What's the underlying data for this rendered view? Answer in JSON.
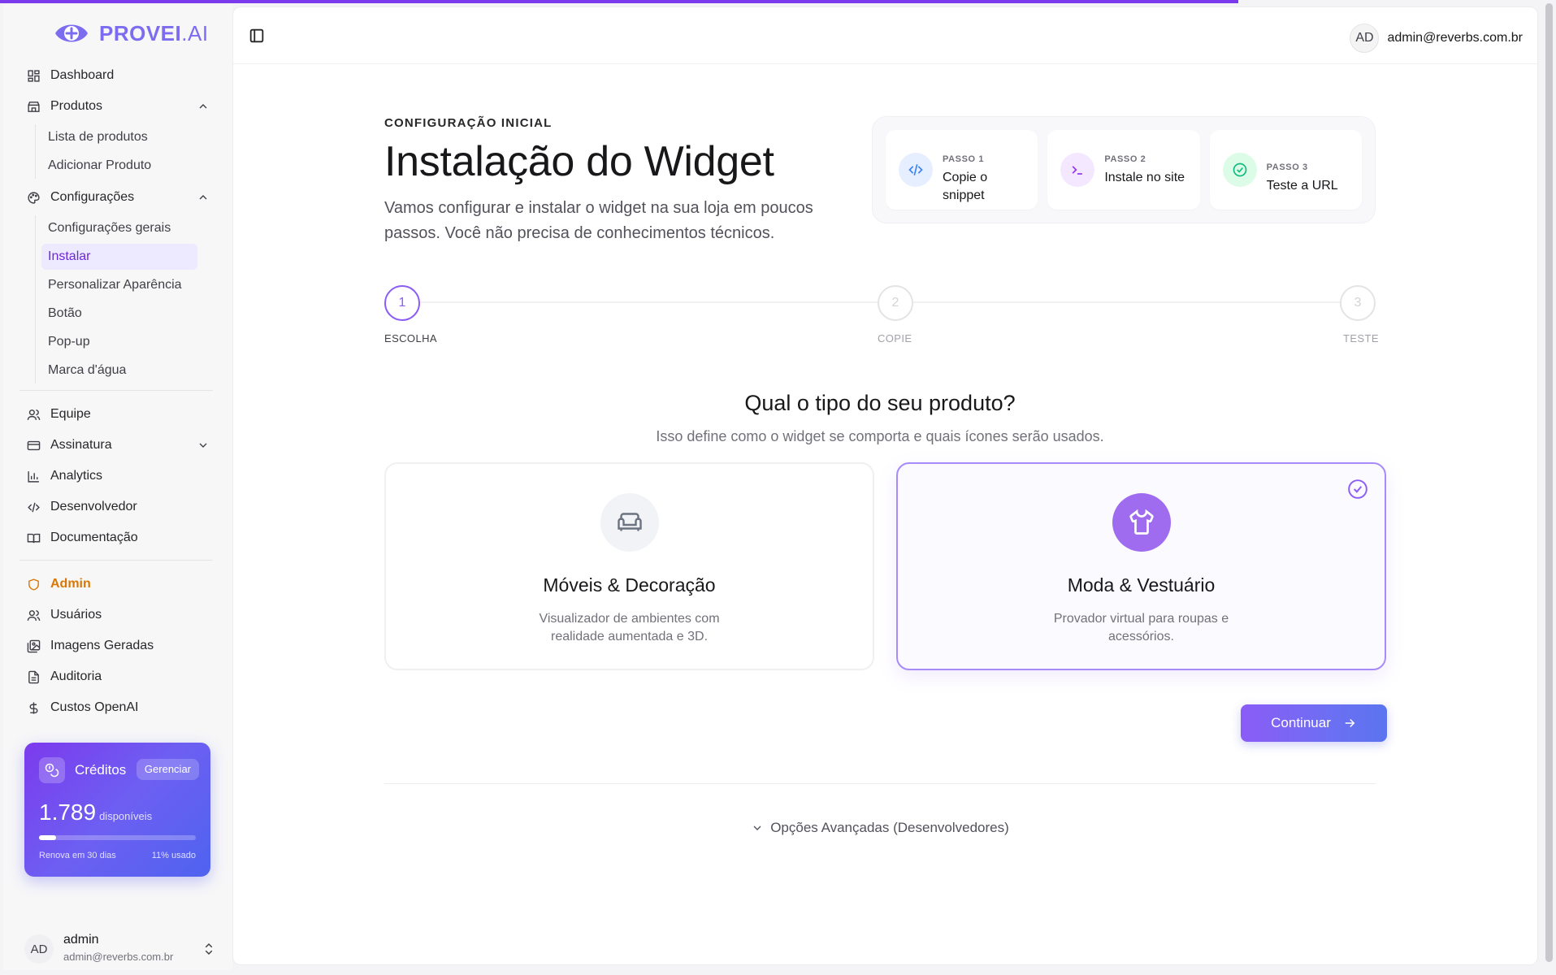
{
  "colors": {
    "accent": "#7c3aed",
    "brand": "#7c6cf0",
    "admin": "#d97706"
  },
  "top_progress": 0.796,
  "brand": {
    "name": "PROVEI",
    "suffix": ".AI"
  },
  "sidebar": {
    "items": [
      {
        "label": "Dashboard",
        "icon": "dashboard-icon"
      },
      {
        "label": "Produtos",
        "icon": "store-icon",
        "expanded": true,
        "children": [
          "Lista de produtos",
          "Adicionar Produto"
        ]
      },
      {
        "label": "Configurações",
        "icon": "palette-icon",
        "expanded": true,
        "children": [
          "Configurações gerais",
          "Instalar",
          "Personalizar Aparência",
          "Botão",
          "Pop-up",
          "Marca d'água"
        ],
        "active_child": "Instalar"
      },
      {
        "label": "Equipe",
        "icon": "users-icon"
      },
      {
        "label": "Assinatura",
        "icon": "credit-card-icon",
        "expanded": false
      },
      {
        "label": "Analytics",
        "icon": "bar-chart-icon"
      },
      {
        "label": "Desenvolvedor",
        "icon": "code-icon"
      },
      {
        "label": "Documentação",
        "icon": "book-icon"
      }
    ],
    "admin_section": {
      "label": "Admin",
      "items": [
        {
          "label": "Usuários",
          "icon": "users-icon"
        },
        {
          "label": "Imagens Geradas",
          "icon": "images-icon"
        },
        {
          "label": "Auditoria",
          "icon": "file-text-icon"
        },
        {
          "label": "Custos OpenAI",
          "icon": "dollar-icon"
        }
      ]
    },
    "credits": {
      "title": "Créditos",
      "manage_label": "Gerenciar",
      "value": "1.789",
      "available_label": "disponíveis",
      "used_fraction": 0.11,
      "renew_text": "Renova em 30 dias",
      "used_text": "11% usado"
    },
    "user": {
      "initials": "AD",
      "name": "admin",
      "email": "admin@reverbs.com.br"
    }
  },
  "topbar": {
    "initials": "AD",
    "email": "admin@reverbs.com.br"
  },
  "header": {
    "kicker": "CONFIGURAÇÃO INICIAL",
    "title": "Instalação do Widget",
    "description": "Vamos configurar e instalar o widget na sua loja em poucos passos. Você não precisa de conhecimentos técnicos."
  },
  "steps_overview": [
    {
      "label": "PASSO 1",
      "text": "Copie o snippet",
      "icon": "code-icon",
      "color": "#3b82f6",
      "bg": "#e6efff"
    },
    {
      "label": "PASSO 2",
      "text": "Instale no site",
      "icon": "terminal-icon",
      "color": "#9333ea",
      "bg": "#f3e8ff"
    },
    {
      "label": "PASSO 3",
      "text": "Teste a URL",
      "icon": "check-circle-icon",
      "color": "#10b981",
      "bg": "#dcfce7"
    }
  ],
  "stepper": [
    {
      "number": "1",
      "label": "ESCOLHA",
      "active": true
    },
    {
      "number": "2",
      "label": "COPIE",
      "active": false
    },
    {
      "number": "3",
      "label": "TESTE",
      "active": false
    }
  ],
  "question": {
    "title": "Qual o tipo do seu produto?",
    "subtitle": "Isso define como o widget se comporta e quais ícones serão usados."
  },
  "options": [
    {
      "title": "Móveis & Decoração",
      "description": "Visualizador de ambientes com realidade aumentada e 3D.",
      "icon": "sofa-icon",
      "selected": false
    },
    {
      "title": "Moda & Vestuário",
      "description": "Provador virtual para roupas e acessórios.",
      "icon": "shirt-icon",
      "selected": true
    }
  ],
  "continue_label": "Continuar",
  "advanced_label": "Opções Avançadas (Desenvolvedores)"
}
